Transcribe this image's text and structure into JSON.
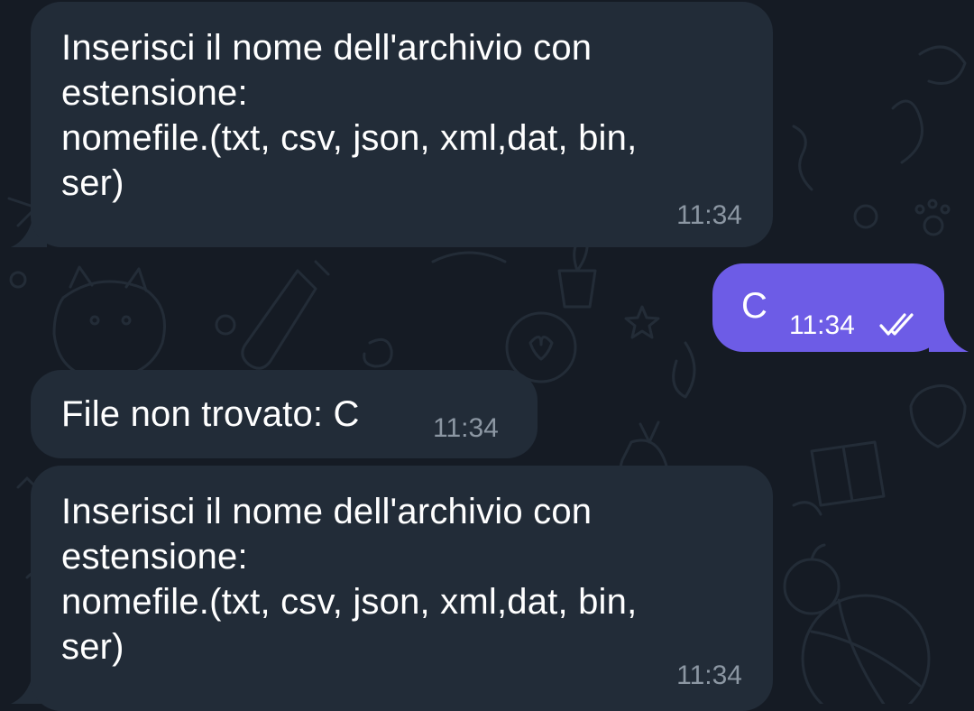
{
  "theme": {
    "background": "#151b24",
    "incoming_bubble": "#222c38",
    "outgoing_bubble": "#6d5ce6",
    "incoming_time": "#8c97a3",
    "outgoing_time": "#ffffff"
  },
  "messages": [
    {
      "direction": "incoming",
      "text": "Inserisci il nome dell'archivio con\nestensione:\nnomefile.(txt, csv, json, xml,dat, bin,\nser)",
      "time": "11:34"
    },
    {
      "direction": "outgoing",
      "text": "C",
      "time": "11:34",
      "status_icon": "double-check-icon"
    },
    {
      "direction": "incoming",
      "text": "File non trovato: C",
      "time": "11:34"
    },
    {
      "direction": "incoming",
      "text": "Inserisci il nome dell'archivio con\nestensione:\nnomefile.(txt, csv, json, xml,dat, bin,\nser)",
      "time": "11:34"
    }
  ]
}
